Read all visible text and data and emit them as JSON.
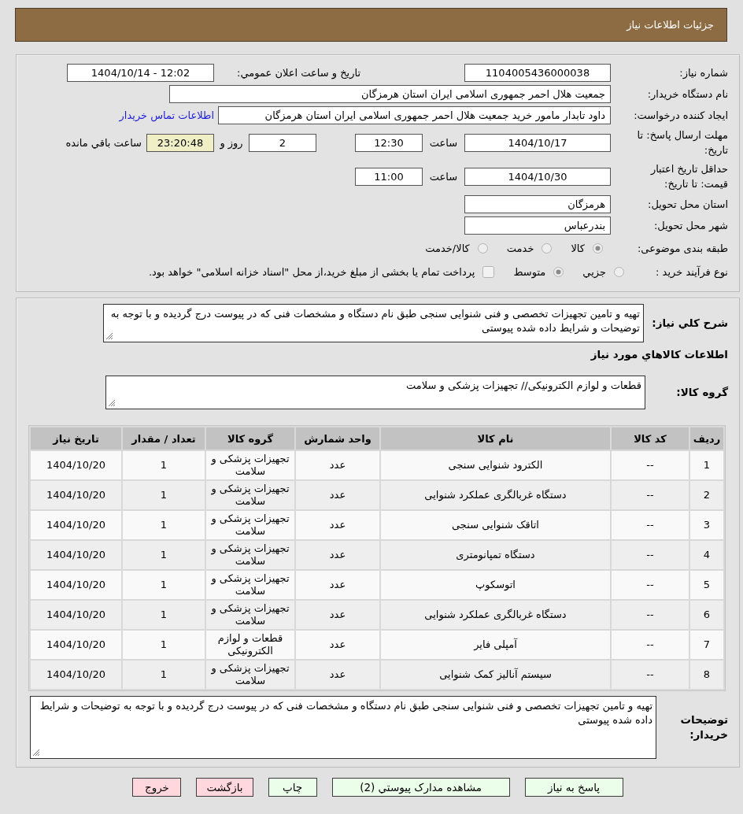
{
  "header": {
    "title": "جزئیات اطلاعات نیاز"
  },
  "need_info": {
    "need_number": {
      "label": "شماره نیاز:",
      "value": "1104005436000038"
    },
    "announce_datetime": {
      "label": "تاریخ و ساعت اعلان عمومي:",
      "value": "1404/10/14 - 12:02"
    },
    "buyer_org": {
      "label": "نام دستگاه خریدار:",
      "value": "جمعیت هلال احمر جمهوری اسلامی ایران استان هرمزگان"
    },
    "requester": {
      "label": "ایجاد کننده درخواست:",
      "value": "داود تابدار مامور خرید جمعیت هلال احمر جمهوری اسلامی ایران استان هرمزگان",
      "contact_link": "اطلاعات تماس خریدار"
    },
    "response_deadline": {
      "label": "مهلت ارسال پاسخ: تا تاریخ:",
      "date": "1404/10/17",
      "time_label": "ساعت",
      "time": "12:30",
      "days": "2",
      "days_label": "روز و",
      "remaining": "23:20:48",
      "remaining_label": "ساعت باقي مانده"
    },
    "price_validity": {
      "label": "حداقل تاریخ اعتبار قیمت: تا تاریخ:",
      "date": "1404/10/30",
      "time_label": "ساعت",
      "time": "11:00"
    },
    "delivery_province": {
      "label": "استان محل تحویل:",
      "value": "هرمزگان"
    },
    "delivery_city": {
      "label": "شهر محل تحویل:",
      "value": "بندرعباس"
    },
    "subject_category": {
      "label": "طبقه بندی موضوعی:",
      "options": [
        {
          "label": "کالا",
          "selected": true
        },
        {
          "label": "خدمت",
          "selected": false
        },
        {
          "label": "کالا/خدمت",
          "selected": false
        }
      ]
    },
    "purchase_process": {
      "label": "نوع فرآیند خرید :",
      "options": [
        {
          "label": "جزيي",
          "selected": false
        },
        {
          "label": "متوسط",
          "selected": true
        }
      ],
      "treasury_payment": {
        "label": "پرداخت تمام یا بخشی از مبلغ خرید،از محل \"اسناد خزانه اسلامی\" خواهد بود.",
        "checked": false
      }
    }
  },
  "need_description": {
    "label": "شرح کلي نیاز:",
    "value": "تهیه و تامین تجهیزات تخصصی و فنی شنوایی سنجی طبق نام دستگاه و مشخصات فنی که در پیوست درج گردیده و با توجه به توضیحات و شرایط داده شده پیوستی"
  },
  "goods": {
    "heading": "اطلاعات کالاهاي مورد نیاز",
    "group": {
      "label": "گروه کالا:",
      "value": "قطعات و لوازم الکترونیکی// تجهیزات پزشکی و سلامت"
    },
    "table": {
      "columns": [
        "ردیف",
        "کد کالا",
        "نام کالا",
        "واحد شمارش",
        "گروه کالا",
        "تعداد / مقدار",
        "تاریخ نیاز"
      ],
      "rows": [
        {
          "row_number": "1",
          "code": "--",
          "name": "الکترود شنوایی سنجی",
          "unit": "عدد",
          "group": "تجهیزات پزشکی و سلامت",
          "quantity": "1",
          "need_date": "1404/10/20"
        },
        {
          "row_number": "2",
          "code": "--",
          "name": "دستگاه غربالگری عملکرد شنوایی",
          "unit": "عدد",
          "group": "تجهیزات پزشکی و سلامت",
          "quantity": "1",
          "need_date": "1404/10/20"
        },
        {
          "row_number": "3",
          "code": "--",
          "name": "اتاقک شنوایی سنجی",
          "unit": "عدد",
          "group": "تجهیزات پزشکی و سلامت",
          "quantity": "1",
          "need_date": "1404/10/20"
        },
        {
          "row_number": "4",
          "code": "--",
          "name": "دستگاه تمپانومتری",
          "unit": "عدد",
          "group": "تجهیزات پزشکی و سلامت",
          "quantity": "1",
          "need_date": "1404/10/20"
        },
        {
          "row_number": "5",
          "code": "--",
          "name": "اتوسکوپ",
          "unit": "عدد",
          "group": "تجهیزات پزشکی و سلامت",
          "quantity": "1",
          "need_date": "1404/10/20"
        },
        {
          "row_number": "6",
          "code": "--",
          "name": "دستگاه غربالگری عملکرد شنوایی",
          "unit": "عدد",
          "group": "تجهیزات پزشکی و سلامت",
          "quantity": "1",
          "need_date": "1404/10/20"
        },
        {
          "row_number": "7",
          "code": "--",
          "name": "آمپلی فایر",
          "unit": "عدد",
          "group": "قطعات و لوازم الکترونیکی",
          "quantity": "1",
          "need_date": "1404/10/20"
        },
        {
          "row_number": "8",
          "code": "--",
          "name": "سیستم آنالیز کمک شنوایی",
          "unit": "عدد",
          "group": "تجهیزات پزشکی و سلامت",
          "quantity": "1",
          "need_date": "1404/10/20"
        }
      ]
    }
  },
  "buyer_notes": {
    "label": "توضیحات خریدار:",
    "value": "تهیه و تامین تجهیزات تخصصی و فنی شنوایی سنجی طبق نام دستگاه و مشخصات فنی که در پیوست درج گردیده و با توجه به توضیحات و شرایط داده شده پیوستی"
  },
  "buttons": [
    {
      "label": "پاسخ به نیاز",
      "kind": "confirm"
    },
    {
      "label": "مشاهده مدارک پيوستي (2)",
      "kind": "confirm"
    },
    {
      "label": "چاپ",
      "kind": "confirm"
    },
    {
      "label": "بازگشت",
      "kind": "cancel"
    },
    {
      "label": "خروج",
      "kind": "cancel"
    }
  ]
}
